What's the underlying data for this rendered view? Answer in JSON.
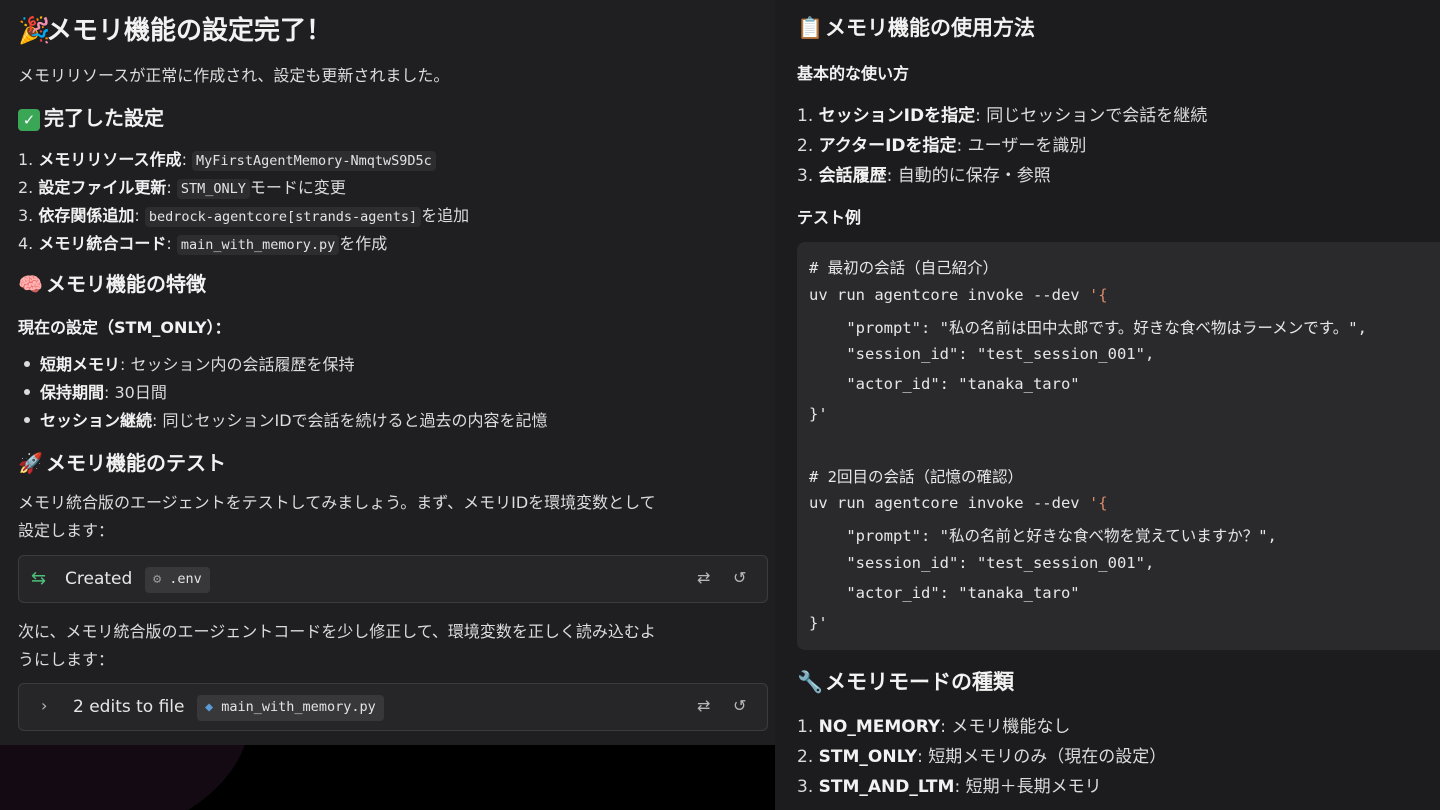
{
  "left": {
    "title": "メモリ機能の設定完了！",
    "intro": "メモリリソースが正常に作成され、設定も更新されました。",
    "done_heading": "完了した設定",
    "done_items": [
      {
        "num": "1.",
        "label": "メモリリソース作成",
        "sep": ": ",
        "code": "MyFirstAgentMemory-NmqtwS9D5c",
        "suffix": ""
      },
      {
        "num": "2.",
        "label": "設定ファイル更新",
        "sep": ": ",
        "code": "STM_ONLY",
        "suffix": "モードに変更"
      },
      {
        "num": "3.",
        "label": "依存関係追加",
        "sep": ": ",
        "code": "bedrock-agentcore[strands-agents]",
        "suffix": "を追加"
      },
      {
        "num": "4.",
        "label": "メモリ統合コード",
        "sep": ": ",
        "code": "main_with_memory.py",
        "suffix": "を作成"
      }
    ],
    "features_heading": "メモリ機能の特徴",
    "current_setting": "現在の設定（STM_ONLY）：",
    "features": [
      {
        "label": "短期メモリ",
        "text": ": セッション内の会話履歴を保持"
      },
      {
        "label": "保持期間",
        "text": ": 30日間"
      },
      {
        "label": "セッション継続",
        "text": ": 同じセッションIDで会話を続けると過去の内容を記憶"
      }
    ],
    "test_heading": "メモリ機能のテスト",
    "test_text_1": "メモリ統合版のエージェントをテストしてみましょう。まず、メモリIDを環境変数として",
    "test_text_2": "設定します：",
    "card1": {
      "label": "Created",
      "file": ".env"
    },
    "next_text_1": "次に、メモリ統合版のエージェントコードを少し修正して、環境変数を正しく読み込むよ",
    "next_text_2": "うにします：",
    "card2": {
      "label": "2 edits to file",
      "file": "main_with_memory.py"
    }
  },
  "right": {
    "usage_heading": "メモリ機能の使用方法",
    "basic_heading": "基本的な使い方",
    "basic_items": [
      {
        "num": "1.",
        "label": "セッションIDを指定",
        "text": ": 同じセッションで会話を継続"
      },
      {
        "num": "2.",
        "label": "アクターIDを指定",
        "text": ": ユーザーを識別"
      },
      {
        "num": "3.",
        "label": "会話履歴",
        "text": ": 自動的に保存・参照"
      }
    ],
    "test_example_heading": "テスト例",
    "code": {
      "c1": "# 最初の会話（自己紹介）",
      "cmd1": "uv run agentcore invoke --dev ",
      "q1": "'{",
      "p1": "    \"prompt\": \"私の名前は田中太郎です。好きな食べ物はラーメンです。\",",
      "s1": "    \"session_id\": \"test_session_001\",",
      "a1": "    \"actor_id\": \"tanaka_taro\"",
      "e1": "}'",
      "c2": "# 2回目の会話（記憶の確認）",
      "cmd2": "uv run agentcore invoke --dev ",
      "q2": "'{",
      "p2": "    \"prompt\": \"私の名前と好きな食べ物を覚えていますか？\",",
      "s2": "    \"session_id\": \"test_session_001\",",
      "a2": "    \"actor_id\": \"tanaka_taro\"",
      "e2": "}'"
    },
    "modes_heading": "メモリモードの種類",
    "modes": [
      {
        "num": "1.",
        "label": "NO_MEMORY",
        "text": ": メモリ機能なし"
      },
      {
        "num": "2.",
        "label": "STM_ONLY",
        "text": ": 短期メモリのみ（現在の設定）"
      },
      {
        "num": "3.",
        "label": "STM_AND_LTM",
        "text": ": 短期＋長期メモリ"
      }
    ]
  }
}
